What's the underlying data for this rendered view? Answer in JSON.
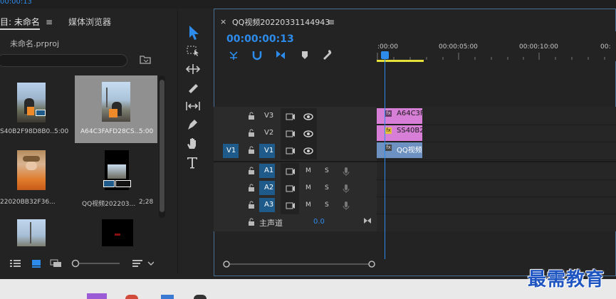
{
  "top": {
    "timecode": "00:00:13"
  },
  "project": {
    "tab_project": "目: 未命名",
    "tab_menu": "≡",
    "tab_media": "媒体浏览器",
    "file_name": "未命名.prproj",
    "thumbs": [
      {
        "name": "S40B2F98D8B0...",
        "dur": "5:00"
      },
      {
        "name": "A64C3FAFD28CS...",
        "dur": "5:00"
      },
      {
        "name": "22020BB32F36...",
        "dur": ""
      },
      {
        "name": "QQ视频202203...",
        "dur": "2;28"
      },
      {
        "name": "",
        "dur": ""
      },
      {
        "name": "",
        "dur": ""
      }
    ]
  },
  "timeline": {
    "close": "×",
    "title": "QQ视频20220331144943",
    "menu": "≡",
    "timecode": "00:00:00:13",
    "ruler": [
      ":00:00",
      "00:00:05:00",
      "00:00:10:00",
      "00:"
    ],
    "video_tracks": [
      {
        "name": "V3",
        "src": ""
      },
      {
        "name": "V2",
        "src": ""
      },
      {
        "name": "V1",
        "src": "V1"
      }
    ],
    "audio_tracks": [
      {
        "name": "A1",
        "m": "M",
        "s": "S"
      },
      {
        "name": "A2",
        "m": "M",
        "s": "S"
      },
      {
        "name": "A3",
        "m": "M",
        "s": "S"
      }
    ],
    "master": {
      "name": "主声道",
      "value": "0.0"
    },
    "clips": {
      "a64": {
        "fx": "fx",
        "label": "A64C3F"
      },
      "ss40": {
        "fx": "fx",
        "label": "SS40B2"
      },
      "qq": {
        "fx": "fx",
        "label": "QQ视频"
      }
    }
  },
  "watermark": "最需教育",
  "colors": {
    "accent": "#2d8ceb",
    "clip_pink": "#d77ed6",
    "clip_blue": "#6d91c1",
    "track_target": "#1e5a8a"
  }
}
